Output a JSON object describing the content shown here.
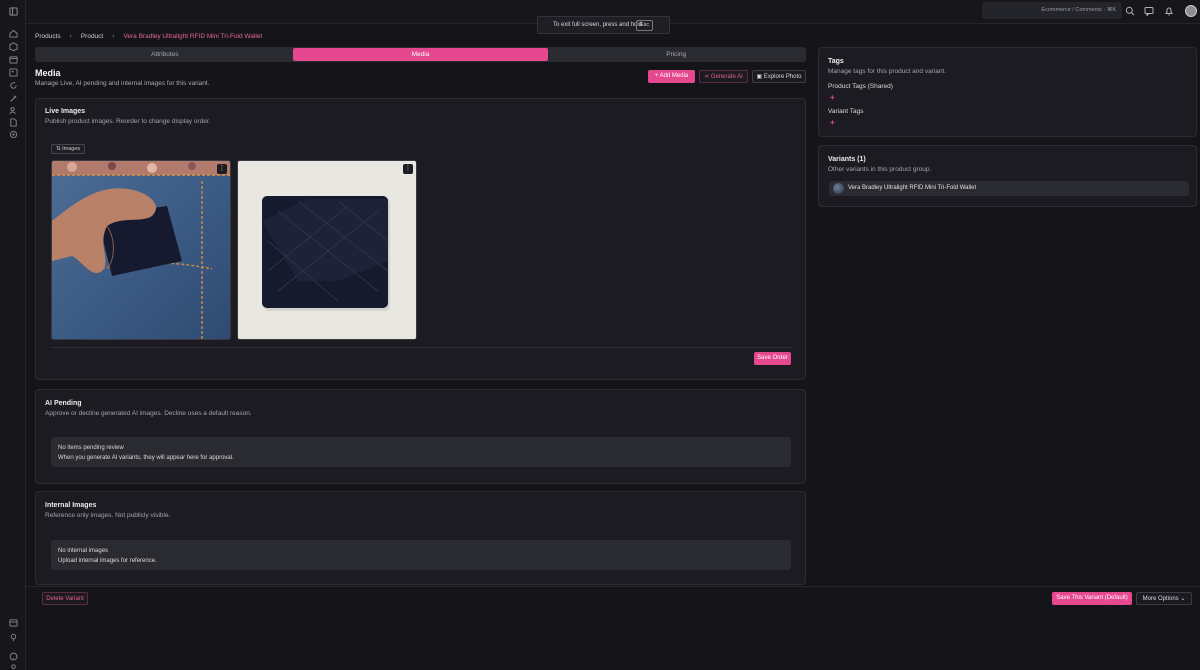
{
  "fullscreen_toast": {
    "text": "To exit full screen, press and hold",
    "key": "Esc"
  },
  "topbar": {
    "search_text": "Ecommerce / Comments · ⌘K"
  },
  "breadcrumb": {
    "items": [
      "Products",
      "Product",
      "Vera Bradley Ultralight RFID Mini Tri-Fold Wallet"
    ]
  },
  "tabs": [
    {
      "label": "Attributes"
    },
    {
      "label": "Media",
      "active": true
    },
    {
      "label": "Pricing"
    }
  ],
  "media": {
    "title": "Media",
    "subtitle": "Manage Live, AI pending and internal images for this variant.",
    "add_media_label": "+ Add Media",
    "generate_ai_label": "Generate AI",
    "explore_photo_label": "Explore Photo"
  },
  "live_images": {
    "title": "Live Images",
    "subtitle": "Publish product images. Reorder to change display order.",
    "chip_label": "Images",
    "save_order_label": "Save Order",
    "images": [
      {
        "alt": "Wallet in jeans pocket"
      },
      {
        "alt": "Navy quilted tri-fold wallet"
      }
    ]
  },
  "ai_pending": {
    "title": "AI Pending",
    "subtitle": "Approve or decline generated AI images. Decline uses a default reason.",
    "empty_title": "No items pending review",
    "empty_text": "When you generate AI variants, they will appear here for approval."
  },
  "internal_images": {
    "title": "Internal Images",
    "subtitle": "Reference only images. Not publicly visible.",
    "empty_title": "No internal images",
    "empty_text": "Upload internal images for reference."
  },
  "tags": {
    "title": "Tags",
    "subtitle": "Manage tags for this product and variant.",
    "product_tags_label": "Product Tags (Shared)",
    "variant_tags_label": "Variant Tags"
  },
  "variants": {
    "title": "Variants (1)",
    "subtitle": "Other variants in this product group.",
    "items": [
      {
        "name": "Vera Bradley Ultralight RFID Mini Tri-Fold Wallet"
      }
    ]
  },
  "footer": {
    "delete_label": "Delete Variant",
    "save_label": "Save This Variant (Default)",
    "more_label": "More Options"
  },
  "colors": {
    "accent": "#e5488e",
    "background": "#141419",
    "card": "#1b1b21"
  }
}
